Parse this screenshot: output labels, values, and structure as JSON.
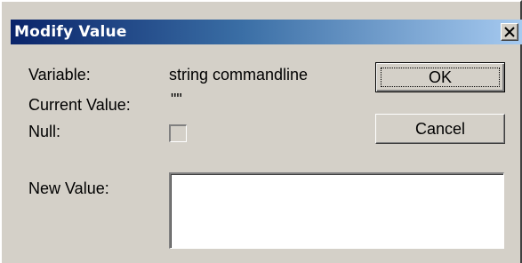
{
  "window": {
    "title": "Modify Value",
    "close_icon": "close-icon"
  },
  "fields": {
    "variable_label": "Variable:",
    "variable_value": "string commandline",
    "current_value_label": "Current Value:",
    "current_value": "\"\"",
    "null_label": "Null:",
    "null_checked": false,
    "new_value_label": "New Value:",
    "new_value": ""
  },
  "buttons": {
    "ok_label": "OK",
    "cancel_label": "Cancel"
  },
  "colors": {
    "face": "#d4d0c8",
    "title_start": "#0a246a",
    "title_end": "#a6caf0",
    "title_text": "#ffffff"
  }
}
